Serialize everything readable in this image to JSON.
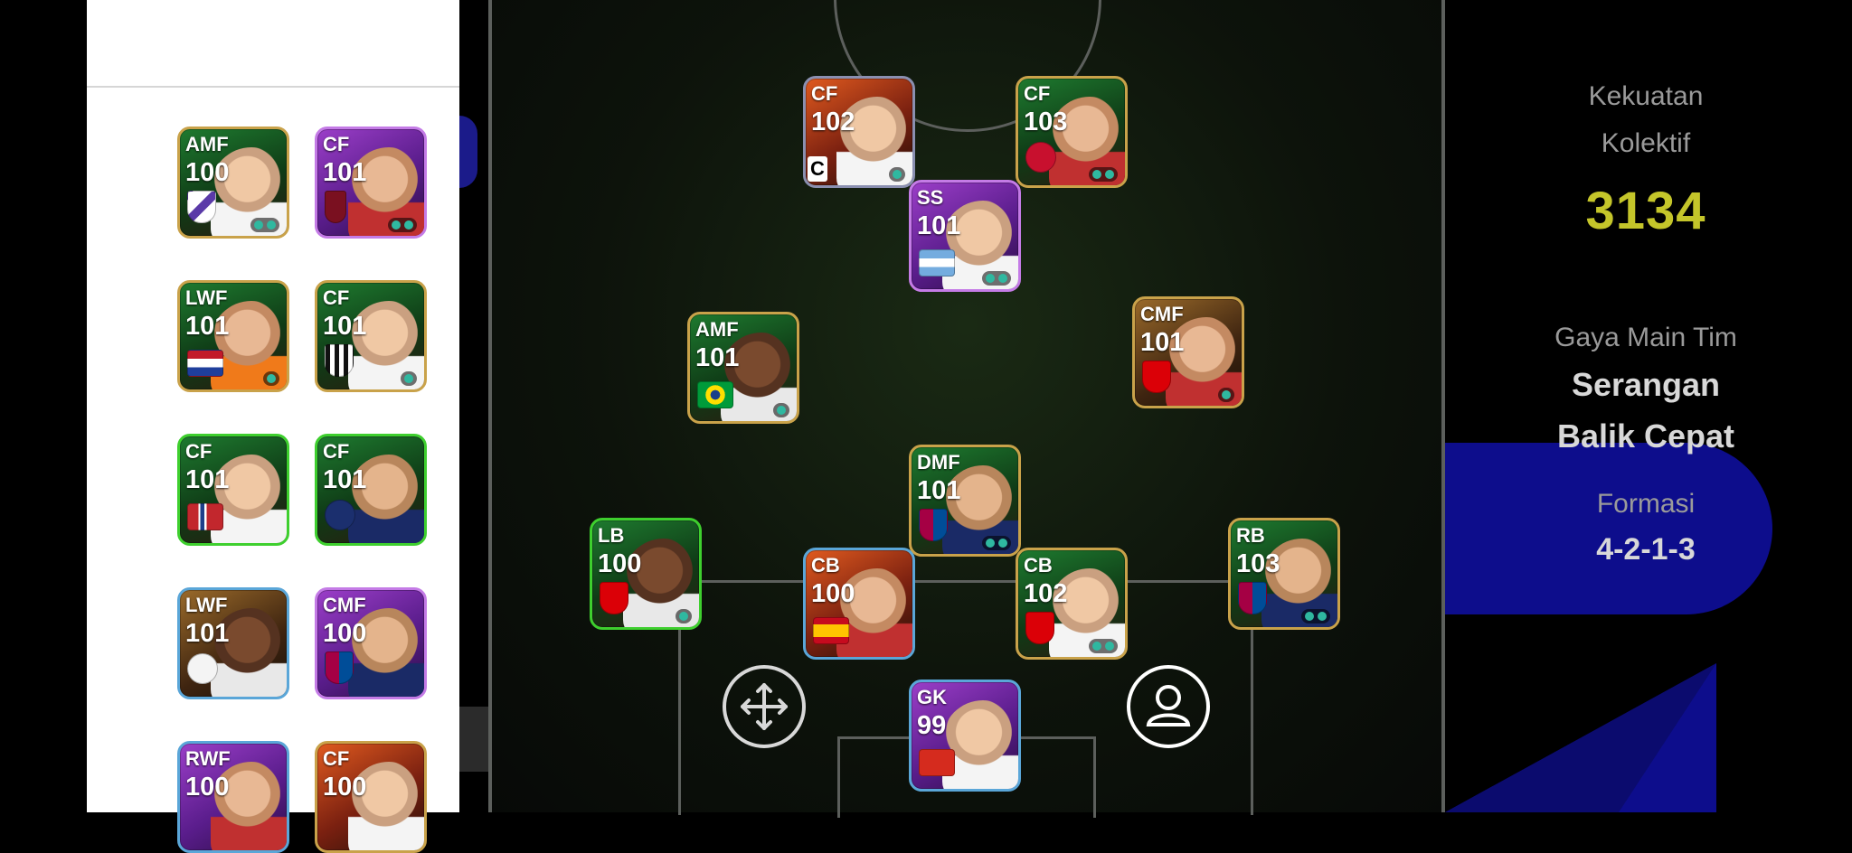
{
  "sidebar": {
    "cards": [
      {
        "position": "AMF",
        "rating": "100",
        "skills": 2
      },
      {
        "position": "CF",
        "rating": "101",
        "skills": 2
      },
      {
        "position": "LWF",
        "rating": "101",
        "skills": 1
      },
      {
        "position": "CF",
        "rating": "101",
        "skills": 1
      },
      {
        "position": "CF",
        "rating": "101",
        "skills": 0
      },
      {
        "position": "CF",
        "rating": "101",
        "skills": 0
      },
      {
        "position": "LWF",
        "rating": "101",
        "skills": 0
      },
      {
        "position": "CMF",
        "rating": "100",
        "skills": 0
      },
      {
        "position": "RWF",
        "rating": "100",
        "skills": 0
      },
      {
        "position": "CF",
        "rating": "100",
        "skills": 0
      }
    ]
  },
  "formation_players": [
    {
      "id": "cf-left",
      "position": "CF",
      "rating": "102",
      "captain": "C"
    },
    {
      "id": "cf-right",
      "position": "CF",
      "rating": "103"
    },
    {
      "id": "ss",
      "position": "SS",
      "rating": "101"
    },
    {
      "id": "amf",
      "position": "AMF",
      "rating": "101"
    },
    {
      "id": "cmf",
      "position": "CMF",
      "rating": "101"
    },
    {
      "id": "dmf",
      "position": "DMF",
      "rating": "101"
    },
    {
      "id": "lb",
      "position": "LB",
      "rating": "100"
    },
    {
      "id": "cb-left",
      "position": "CB",
      "rating": "100"
    },
    {
      "id": "cb-right",
      "position": "CB",
      "rating": "102"
    },
    {
      "id": "rb",
      "position": "RB",
      "rating": "103"
    },
    {
      "id": "gk",
      "position": "GK",
      "rating": "99"
    }
  ],
  "team_info": {
    "strength_label_1": "Kekuatan",
    "strength_label_2": "Kolektif",
    "strength_value": "3134",
    "playstyle_label": "Gaya Main Tim",
    "playstyle_value_1": "Serangan",
    "playstyle_value_2": "Balik Cepat",
    "formation_label": "Formasi",
    "formation_value": "4-2-1-3"
  },
  "icons": {
    "move": "move-arrows-icon",
    "player": "person-icon"
  },
  "colors": {
    "strength_value": "#c4c52a",
    "panel_blue": "#0d0d8c",
    "skill_dot": "#2fb8a0"
  }
}
